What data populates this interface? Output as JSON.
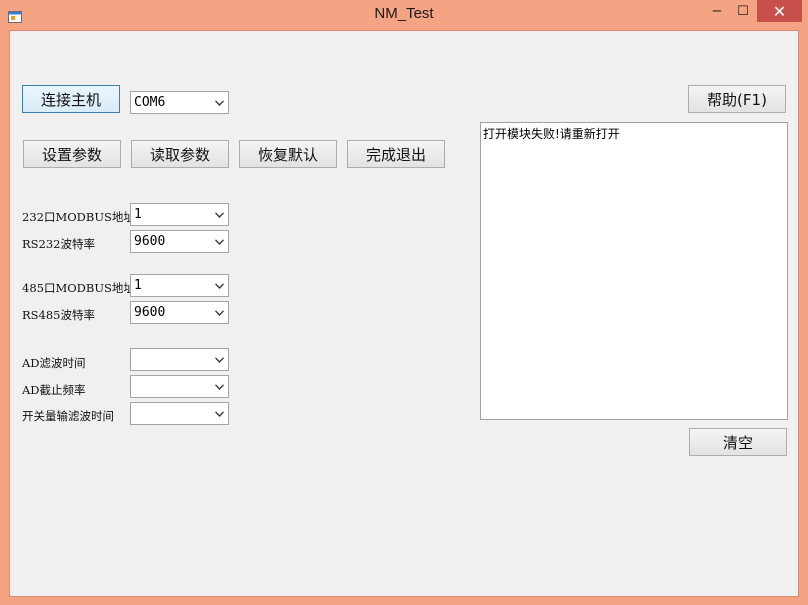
{
  "window": {
    "title": "NM_Test",
    "minimize": "−",
    "maximize": "☐",
    "close": "✕"
  },
  "toolbar": {
    "connect_label": "连接主机",
    "port_value": "COM6",
    "help_label": "帮助(F1)",
    "set_label": "设置参数",
    "read_label": "读取参数",
    "restore_label": "恢复默认",
    "finish_label": "完成退出",
    "clear_label": "清空"
  },
  "fields": {
    "rs232_addr_label": "232口MODBUS地址",
    "rs232_addr_value": "1",
    "rs232_baud_label": "RS232波特率",
    "rs232_baud_value": "9600",
    "rs485_addr_label": "485口MODBUS地址",
    "rs485_addr_value": "1",
    "rs485_baud_label": "RS485波特率",
    "rs485_baud_value": "9600",
    "ad_filter_label": "AD滤波时间",
    "ad_filter_value": "",
    "ad_cutoff_label": "AD截止频率",
    "ad_cutoff_value": "",
    "di_filter_label": "开关量输滤波时间",
    "di_filter_value": ""
  },
  "output": {
    "text": "打开模块失败!请重新打开"
  }
}
